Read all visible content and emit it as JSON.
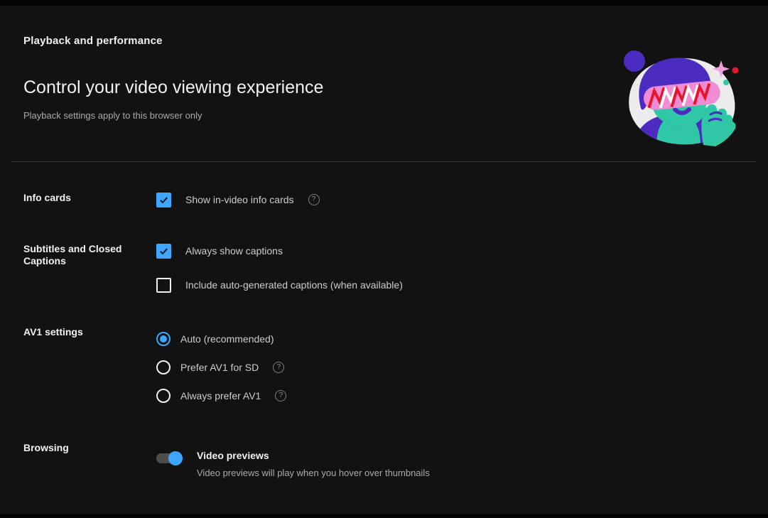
{
  "colors": {
    "background": "#121212",
    "accent": "#3ea6ff",
    "text_primary": "#f1f1f1",
    "text_secondary": "#aaaaaa",
    "divider": "#3d3d3d"
  },
  "header": {
    "category": "Playback and performance",
    "title": "Control your video viewing experience",
    "subtitle": "Playback settings apply to this browser only",
    "illustration": "person-wearing-lightning-bolt-sunglasses"
  },
  "icons": {
    "help_glyph": "?"
  },
  "sections": [
    {
      "label": "Info cards",
      "items": [
        {
          "type": "checkbox",
          "checked": true,
          "label": "Show in-video info cards",
          "has_help": true
        }
      ]
    },
    {
      "label": "Subtitles and Closed Captions",
      "items": [
        {
          "type": "checkbox",
          "checked": true,
          "label": "Always show captions",
          "has_help": false
        },
        {
          "type": "checkbox",
          "checked": false,
          "label": "Include auto-generated captions (when available)",
          "has_help": false
        }
      ]
    },
    {
      "label": "AV1 settings",
      "items": [
        {
          "type": "radio",
          "checked": true,
          "label": "Auto (recommended)",
          "has_help": false
        },
        {
          "type": "radio",
          "checked": false,
          "label": "Prefer AV1 for SD",
          "has_help": true
        },
        {
          "type": "radio",
          "checked": false,
          "label": "Always prefer AV1",
          "has_help": true
        }
      ]
    },
    {
      "label": "Browsing",
      "items": [
        {
          "type": "toggle",
          "checked": true,
          "label": "Video previews",
          "description": "Video previews will play when you hover over thumbnails"
        }
      ]
    }
  ]
}
